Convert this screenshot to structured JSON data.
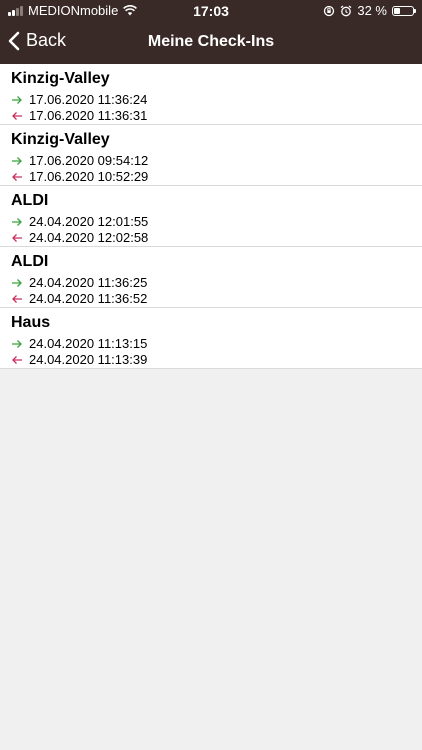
{
  "status": {
    "carrier": "MEDIONmobile",
    "time": "17:03",
    "battery": "32 %",
    "battery_level": 0.32
  },
  "nav": {
    "back_label": "Back",
    "title": "Meine Check-Ins"
  },
  "colors": {
    "header": "#3a2a27",
    "check_in": "#3aa540",
    "check_out": "#c8325a"
  },
  "checkins": [
    {
      "place": "Kinzig-Valley",
      "in": "17.06.2020 11:36:24",
      "out": "17.06.2020 11:36:31"
    },
    {
      "place": "Kinzig-Valley",
      "in": "17.06.2020 09:54:12",
      "out": "17.06.2020 10:52:29"
    },
    {
      "place": "ALDI",
      "in": "24.04.2020 12:01:55",
      "out": "24.04.2020 12:02:58"
    },
    {
      "place": "ALDI",
      "in": "24.04.2020 11:36:25",
      "out": "24.04.2020 11:36:52"
    },
    {
      "place": "Haus",
      "in": "24.04.2020 11:13:15",
      "out": "24.04.2020 11:13:39"
    }
  ]
}
